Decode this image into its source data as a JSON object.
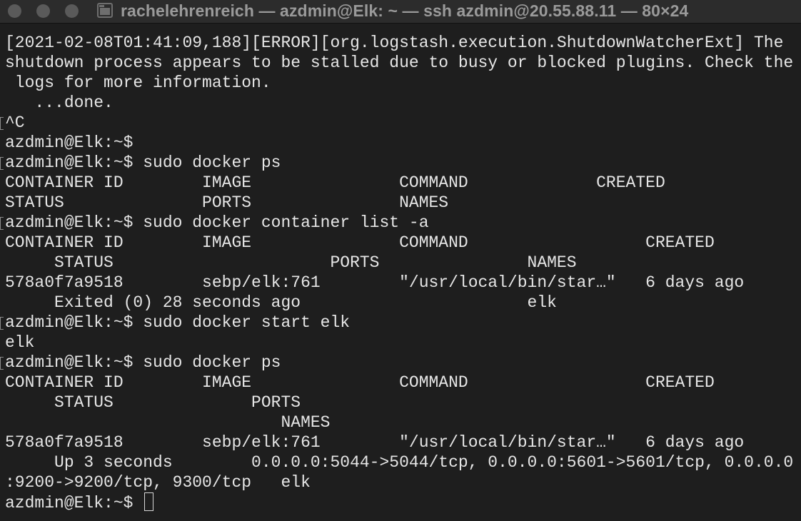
{
  "window": {
    "title": "rachelehrenreich — azdmin@Elk: ~ — ssh azdmin@20.55.88.11 — 80×24",
    "title_icon": "folder-icon",
    "buttons": [
      "close",
      "minimize",
      "zoom"
    ]
  },
  "terminal": {
    "lines": [
      "[2021-02-08T01:41:09,188][ERROR][org.logstash.execution.ShutdownWatcherExt] The",
      "shutdown process appears to be stalled due to busy or blocked plugins. Check the",
      " logs for more information.",
      "   ...done.",
      "^C",
      "azdmin@Elk:~$",
      "azdmin@Elk:~$ sudo docker ps",
      "CONTAINER ID        IMAGE               COMMAND             CREATED",
      "STATUS              PORTS               NAMES",
      "azdmin@Elk:~$ sudo docker container list -a",
      "CONTAINER ID        IMAGE               COMMAND                  CREATED",
      "     STATUS                      PORTS               NAMES",
      "578a0f7a9518        sebp/elk:761        \"/usr/local/bin/star…\"   6 days ago",
      "     Exited (0) 28 seconds ago                       elk",
      "azdmin@Elk:~$ sudo docker start elk",
      "elk",
      "azdmin@Elk:~$ sudo docker ps",
      "CONTAINER ID        IMAGE               COMMAND                  CREATED",
      "     STATUS              PORTS",
      "                            NAMES",
      "578a0f7a9518        sebp/elk:761        \"/usr/local/bin/star…\"   6 days ago",
      "     Up 3 seconds        0.0.0.0:5044->5044/tcp, 0.0.0.0:5601->5601/tcp, 0.0.0.0",
      ":9200->9200/tcp, 9300/tcp   elk"
    ],
    "prompt": "azdmin@Elk:~$ "
  }
}
